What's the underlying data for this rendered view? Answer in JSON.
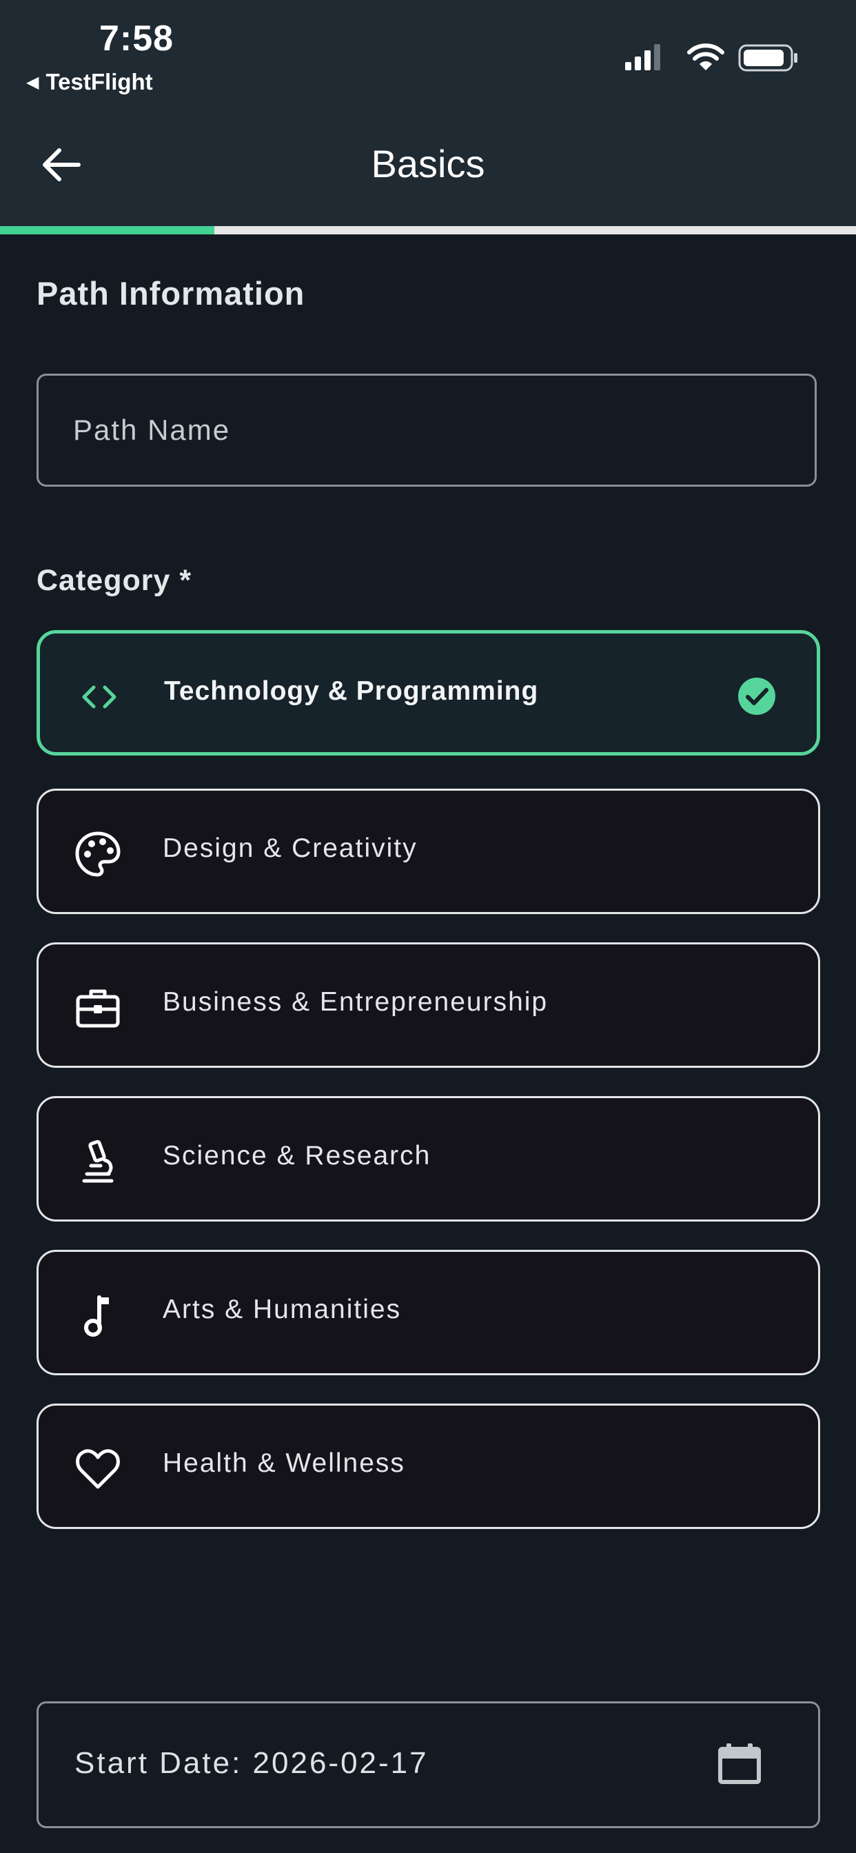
{
  "status_bar": {
    "time": "7:58",
    "back_app": "TestFlight",
    "icons": [
      "signal-icon",
      "wifi-icon",
      "battery-icon"
    ]
  },
  "nav": {
    "title": "Basics",
    "back_icon": "arrow-left-icon"
  },
  "progress": {
    "fraction": 0.25,
    "fill_color": "#42d392"
  },
  "section_title": "Path Information",
  "path_name": {
    "placeholder": "Path Name",
    "value": ""
  },
  "category_label": "Category *",
  "categories": [
    {
      "label": "Technology & Programming",
      "icon": "code-icon",
      "selected": true
    },
    {
      "label": "Design & Creativity",
      "icon": "palette-icon",
      "selected": false
    },
    {
      "label": "Business & Entrepreneurship",
      "icon": "briefcase-icon",
      "selected": false
    },
    {
      "label": "Science & Research",
      "icon": "microscope-icon",
      "selected": false
    },
    {
      "label": "Arts & Humanities",
      "icon": "music-note-icon",
      "selected": false
    },
    {
      "label": "Health & Wellness",
      "icon": "heart-icon",
      "selected": false
    }
  ],
  "start_date": {
    "text": "Start Date: 2026-02-17",
    "icon": "calendar-icon"
  },
  "colors": {
    "accent": "#56d59a",
    "background": "#141a21",
    "header": "#1f2a33"
  }
}
